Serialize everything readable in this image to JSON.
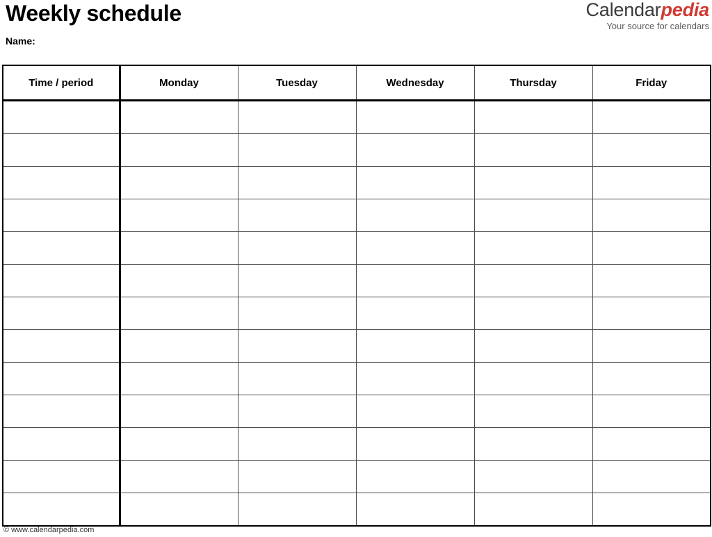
{
  "document": {
    "title": "Weekly schedule",
    "name_label": "Name:"
  },
  "logo": {
    "word_first": "Calendar",
    "word_second": "pedia",
    "tagline": "Your source for calendars",
    "color_first": "#3b3b3b",
    "color_second": "#cf3a32"
  },
  "table": {
    "headers": [
      "Time / period",
      "Monday",
      "Tuesday",
      "Wednesday",
      "Thursday",
      "Friday"
    ],
    "row_count": 13,
    "rows": [
      [
        "",
        "",
        "",
        "",
        "",
        ""
      ],
      [
        "",
        "",
        "",
        "",
        "",
        ""
      ],
      [
        "",
        "",
        "",
        "",
        "",
        ""
      ],
      [
        "",
        "",
        "",
        "",
        "",
        ""
      ],
      [
        "",
        "",
        "",
        "",
        "",
        ""
      ],
      [
        "",
        "",
        "",
        "",
        "",
        ""
      ],
      [
        "",
        "",
        "",
        "",
        "",
        ""
      ],
      [
        "",
        "",
        "",
        "",
        "",
        ""
      ],
      [
        "",
        "",
        "",
        "",
        "",
        ""
      ],
      [
        "",
        "",
        "",
        "",
        "",
        ""
      ],
      [
        "",
        "",
        "",
        "",
        "",
        ""
      ],
      [
        "",
        "",
        "",
        "",
        "",
        ""
      ],
      [
        "",
        "",
        "",
        "",
        "",
        ""
      ]
    ]
  },
  "footer": {
    "copyright": "© www.calendarpedia.com"
  }
}
